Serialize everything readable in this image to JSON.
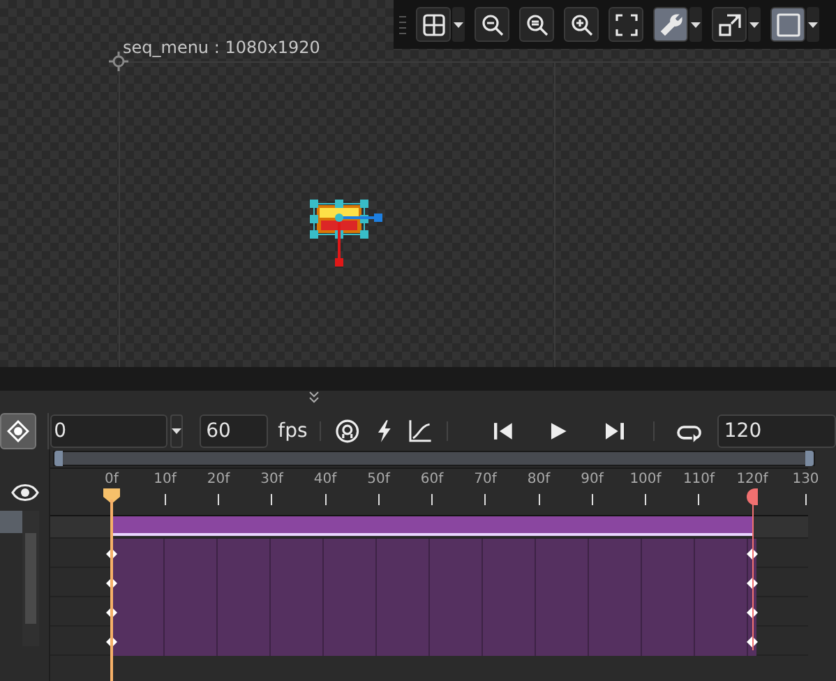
{
  "viewport": {
    "toolbar": [
      {
        "kind": "grid",
        "selected": false,
        "dropdown": true
      },
      {
        "kind": "zoom-out",
        "selected": false,
        "dropdown": false
      },
      {
        "kind": "zoom-reset",
        "selected": false,
        "dropdown": false
      },
      {
        "kind": "zoom-in",
        "selected": false,
        "dropdown": false
      },
      {
        "kind": "fit",
        "selected": false,
        "dropdown": false
      },
      {
        "kind": "wrench",
        "selected": true,
        "dropdown": true
      },
      {
        "kind": "external",
        "selected": false,
        "dropdown": true
      },
      {
        "kind": "frame",
        "selected": true,
        "dropdown": true
      }
    ],
    "canvas_label": "seq_menu : 1080x1920"
  },
  "timeline": {
    "range_slider": {
      "level": 1
    },
    "frame_field": "0",
    "fps_field": "60",
    "fps_label": "fps",
    "end_field": "120",
    "ruler": [
      "0f",
      "10f",
      "20f",
      "30f",
      "40f",
      "50f",
      "60f",
      "70f",
      "80f",
      "90f",
      "100f",
      "110f",
      "120f",
      "130"
    ],
    "tracks": [
      {
        "kind": "summary"
      },
      {
        "kind": "layer"
      },
      {
        "kind": "layer"
      },
      {
        "kind": "layer"
      },
      {
        "kind": "layer"
      }
    ]
  }
}
